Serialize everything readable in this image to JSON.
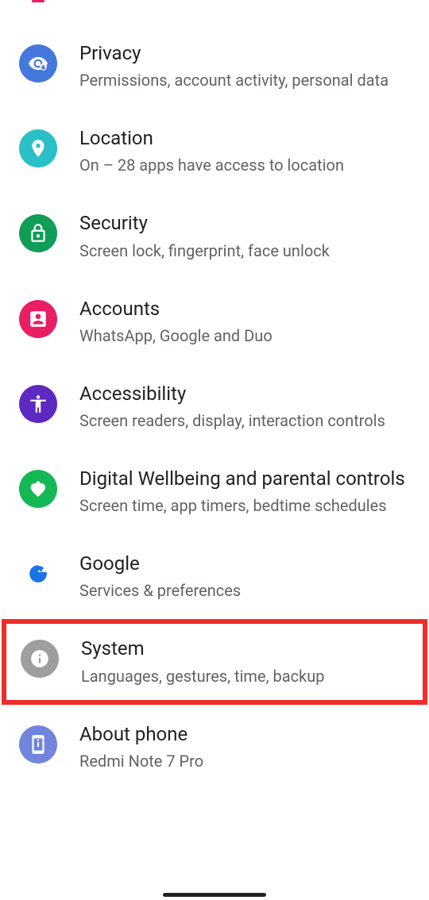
{
  "cutoff": {
    "text": ""
  },
  "items": [
    {
      "title": "Privacy",
      "subtitle": "Permissions, account activity, personal data",
      "iconColor": "#4578DD",
      "iconName": "privacy-icon"
    },
    {
      "title": "Location",
      "subtitle": "On – 28 apps have access to location",
      "iconColor": "#29C0C7",
      "iconName": "location-icon"
    },
    {
      "title": "Security",
      "subtitle": "Screen lock, fingerprint, face unlock",
      "iconColor": "#0F9D58",
      "iconName": "security-icon"
    },
    {
      "title": "Accounts",
      "subtitle": "WhatsApp, Google and Duo",
      "iconColor": "#E91E63",
      "iconName": "accounts-icon"
    },
    {
      "title": "Accessibility",
      "subtitle": "Screen readers, display, interaction controls",
      "iconColor": "#5E29C0",
      "iconName": "accessibility-icon"
    },
    {
      "title": "Digital Wellbeing and parental controls",
      "subtitle": "Screen time, app timers, bedtime schedules",
      "iconColor": "#15B854",
      "iconName": "wellbeing-icon"
    },
    {
      "title": "Google",
      "subtitle": "Services & preferences",
      "iconColor": "#FFFFFF",
      "iconName": "google-icon"
    },
    {
      "title": "System",
      "subtitle": "Languages, gestures, time, backup",
      "iconColor": "#9E9E9E",
      "iconName": "system-icon"
    },
    {
      "title": "About phone",
      "subtitle": "Redmi Note 7 Pro",
      "iconColor": "#7085DB",
      "iconName": "about-icon"
    }
  ]
}
